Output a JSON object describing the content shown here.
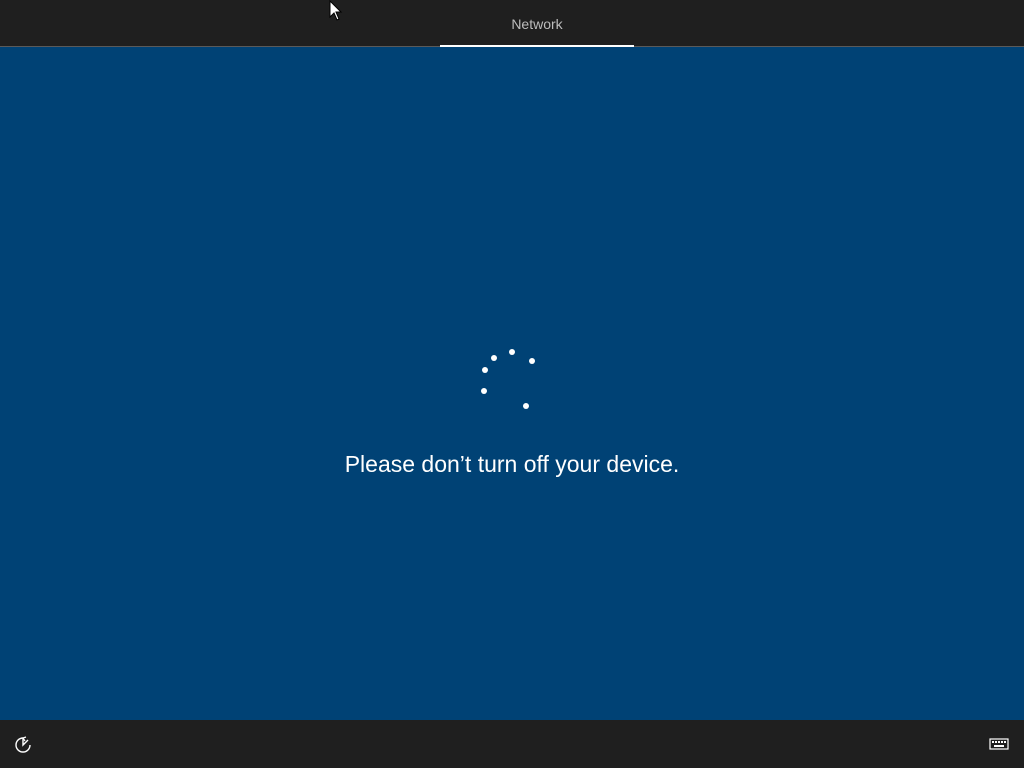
{
  "header": {
    "tabs": [
      {
        "label": "Network",
        "active": true
      }
    ]
  },
  "main": {
    "status_message": "Please don’t turn off your device.",
    "spinner_icon": "loading-spinner-icon"
  },
  "footer": {
    "left_icon": "ease-of-access-icon",
    "right_icon": "keyboard-icon"
  },
  "colors": {
    "background": "#004275",
    "bar": "#1f1f1f",
    "text": "#ffffff",
    "tab_text": "#bdbdbd"
  }
}
